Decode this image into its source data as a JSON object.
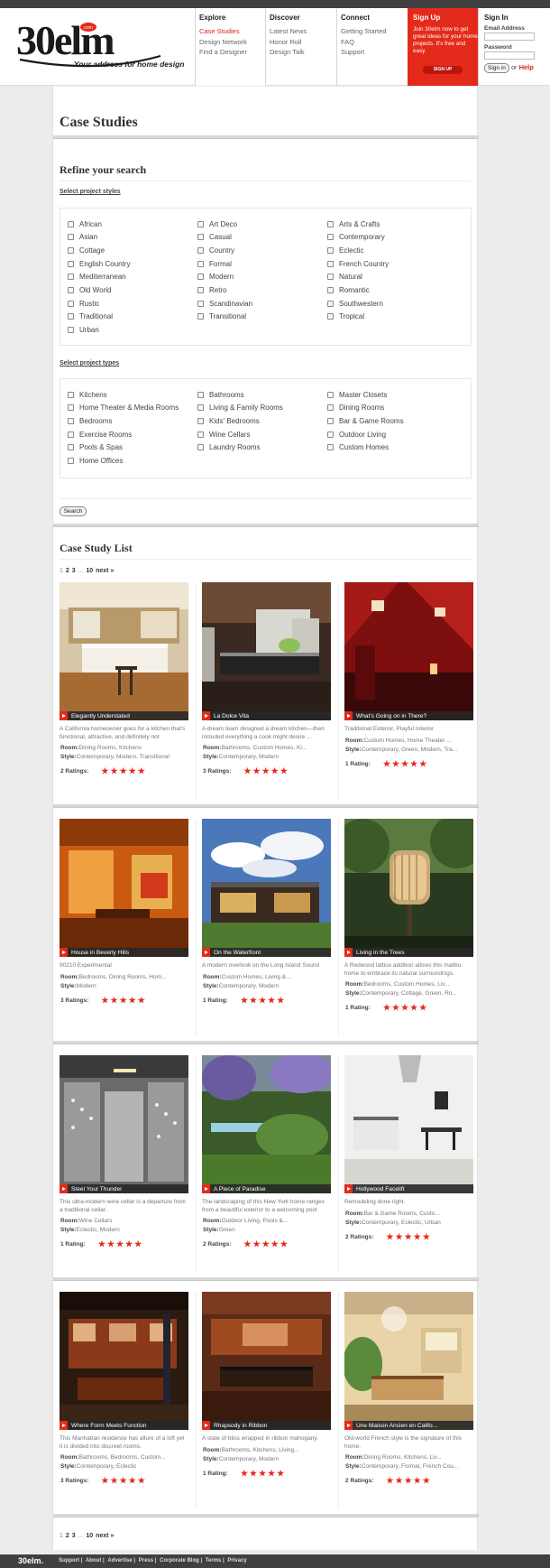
{
  "brand": {
    "logo_text": "30elm",
    "logo_badge": ".com",
    "tagline": "Your address for home design"
  },
  "nav": {
    "explore": {
      "title": "Explore",
      "links": [
        "Case Studies",
        "Design Network",
        "Find a Designer"
      ]
    },
    "discover": {
      "title": "Discover",
      "links": [
        "Latest News",
        "Honor Roll",
        "Design Talk"
      ]
    },
    "connect": {
      "title": "Connect",
      "links": [
        "Getting Started",
        "FAQ",
        "Support"
      ]
    }
  },
  "signup": {
    "title": "Sign Up",
    "text": "Join 30elm now to get great ideas for your home projects. It's free and easy.",
    "button": "SIGN UP"
  },
  "signin": {
    "title": "Sign In",
    "email_label": "Email Address",
    "password_label": "Password",
    "button": "Sign in",
    "or": "or",
    "help": "Help"
  },
  "page": {
    "title": "Case Studies",
    "refine_title": "Refine your search",
    "styles_label": "Select project styles",
    "types_label": "Select project types",
    "search_button": "Search",
    "list_title": "Case Study List"
  },
  "styles": [
    "African",
    "Art Deco",
    "Arts & Crafts",
    "Asian",
    "Casual",
    "Contemporary",
    "Cottage",
    "Country",
    "Eclectic",
    "English Country",
    "Formal",
    "French Country",
    "Mediterranean",
    "Modern",
    "Natural",
    "Old World",
    "Retro",
    "Romantic",
    "Rustic",
    "Scandinavian",
    "Southwestern",
    "Traditional",
    "Transitional",
    "Tropical",
    "Urban"
  ],
  "types": [
    "Kitchens",
    "Bathrooms",
    "Master Closets",
    "Home Theater & Media Rooms",
    "Living & Family Rooms",
    "Dining Rooms",
    "Bedrooms",
    "Kids' Bedrooms",
    "Bar & Game Rooms",
    "Exercise Rooms",
    "Wine Cellars",
    "Outdoor Living",
    "Pools & Spas",
    "Laundry Rooms",
    "Custom Homes",
    "Home Offices"
  ],
  "pager": {
    "pages": [
      "1",
      "2",
      "3"
    ],
    "ellipsis": "...",
    "last": "10",
    "next": "next »"
  },
  "labels": {
    "room": "Room:",
    "style": "Style:"
  },
  "cases": [
    {
      "title": "Elegantly Understated",
      "desc": "A California homeowner goes for a kitchen that's functional, attractive, and definitely not",
      "room": "Dining Rooms, Kitchens",
      "style": "Contemporary, Modern, Transitional",
      "ratings": "2 Ratings:",
      "stars": 5,
      "image": "kitchen-wood-island"
    },
    {
      "title": "La Dolce Vita",
      "desc": "A dream team designed a dream kitchen—then included everything a cook might desire ...",
      "room": "Bathrooms, Custom Homes, Ki...",
      "style": "Contemporary, Modern",
      "ratings": "3 Ratings:",
      "stars": 5,
      "image": "dark-kitchen"
    },
    {
      "title": "What's Going on in There?",
      "desc": "Traditional Exterior, Playful Interior",
      "room": "Custom Homes, Home Theater ...",
      "style": "Contemporary, Green, Modern, Tra...",
      "ratings": "1 Rating:",
      "stars": 5,
      "image": "red-room"
    },
    {
      "title": "House in Beverly Hills",
      "desc": "90210 Experimental",
      "room": "Bedrooms, Dining Rooms, Hom...",
      "style": "Modern",
      "ratings": "3 Ratings:",
      "stars": 5,
      "image": "orange-room"
    },
    {
      "title": "On the Waterfront",
      "desc": "A modern overlook on the Long Island Sound",
      "room": "Custom Homes, Living & ...",
      "style": "Contemporary, Modern",
      "ratings": "1 Rating:",
      "stars": 5,
      "image": "house-sky"
    },
    {
      "title": "Living in the Trees",
      "desc": "A Redwood lattice addition allows this malibu home to embrace its natural surroundings.",
      "room": "Bedrooms, Custom Homes, Liv...",
      "style": "Contemporary, Cottage, Green, Ro...",
      "ratings": "1 Rating:",
      "stars": 5,
      "image": "tree-house"
    },
    {
      "title": "Steel Your Thunder",
      "desc": "This ultra-modern wine cellar is a departure from a traditional cellar.",
      "room": "Wine Cellars",
      "style": "Eclectic, Modern",
      "ratings": "1 Rating:",
      "stars": 5,
      "image": "wine-cellar"
    },
    {
      "title": "A Piece of Paradise",
      "desc": "The landscaping of this New York home ranges from a beautiful exterior to a welcoming pool",
      "room": "Outdoor Living, Pools &...",
      "style": "Green",
      "ratings": "2 Ratings:",
      "stars": 5,
      "image": "garden"
    },
    {
      "title": "Hollywood Facelift",
      "desc": "Remodeling done right.",
      "room": "Bar & Game Rooms, Custo...",
      "style": "Contemporary, Eclectic, Urban",
      "ratings": "2 Ratings:",
      "stars": 5,
      "image": "white-kitchen"
    },
    {
      "title": "Where Form Meets Function",
      "desc": "This Manhattan residence has allure of a loft yet it is divided into discreet rooms.",
      "room": "Bathrooms, Bedrooms, Custom...",
      "style": "Contemporary, Eclectic",
      "ratings": "3 Ratings:",
      "stars": 5,
      "image": "loft-kitchen"
    },
    {
      "title": "Rhapsody in Ribbon",
      "desc": "A state of bliss wrapped in ribbon mahogany.",
      "room": "Bathrooms, Kitchens, Living...",
      "style": "Contemporary, Modern",
      "ratings": "1 Rating:",
      "stars": 5,
      "image": "mahogany-kitchen"
    },
    {
      "title": "Une Maison Ancien en Califo...",
      "desc": "Old-world French style is the signature of this home.",
      "room": "Dining Rooms, Kitchens, Liv...",
      "style": "Contemporary, Formal, French Cou...",
      "ratings": "2 Ratings:",
      "stars": 5,
      "image": "french-kitchen"
    }
  ],
  "footer": {
    "logo": "30elm.",
    "links": [
      "Support",
      "About",
      "Advertise",
      "Press",
      "Corporate Blog",
      "Terms",
      "Privacy"
    ]
  },
  "colors": {
    "accent": "#e42a1a",
    "topbar": "#404040"
  }
}
